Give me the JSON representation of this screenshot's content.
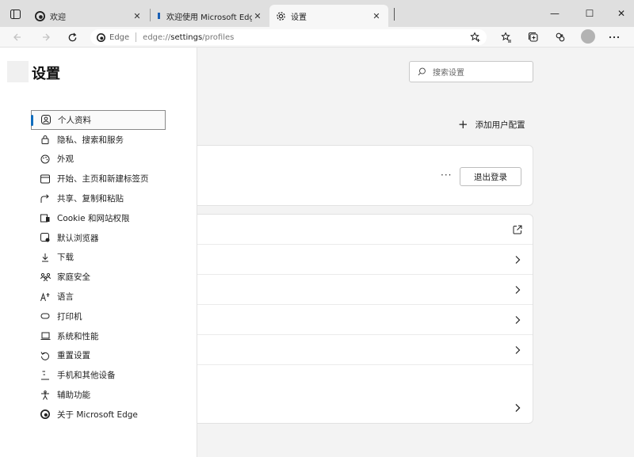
{
  "tabs": [
    {
      "label": "欢迎",
      "close": "✕"
    },
    {
      "label": "欢迎使用 Microsoft Edge",
      "close": "✕"
    },
    {
      "label": "设置",
      "close": "✕"
    }
  ],
  "window": {
    "minimize": "—",
    "maximize": "☐",
    "close": "✕"
  },
  "address": {
    "site": "Edge",
    "url_prefix": "edge://",
    "url_bold": "settings",
    "url_suffix": "/profiles"
  },
  "settings": {
    "title": "设置",
    "search_placeholder": "搜索设置",
    "add_profile": "添加用户配置",
    "more_label": "···",
    "signout_label": "退出登录"
  },
  "nav_items": [
    {
      "label": "个人资料",
      "icon": "profile-icon"
    },
    {
      "label": "隐私、搜索和服务",
      "icon": "lock-icon"
    },
    {
      "label": "外观",
      "icon": "appearance-icon"
    },
    {
      "label": "开始、主页和新建标签页",
      "icon": "home-tab-icon"
    },
    {
      "label": "共享、复制和粘贴",
      "icon": "share-icon"
    },
    {
      "label": "Cookie 和网站权限",
      "icon": "permissions-icon"
    },
    {
      "label": "默认浏览器",
      "icon": "default-browser-icon"
    },
    {
      "label": "下载",
      "icon": "download-icon"
    },
    {
      "label": "家庭安全",
      "icon": "family-icon"
    },
    {
      "label": "语言",
      "icon": "language-icon"
    },
    {
      "label": "打印机",
      "icon": "printer-icon"
    },
    {
      "label": "系统和性能",
      "icon": "laptop-icon"
    },
    {
      "label": "重置设置",
      "icon": "reset-icon"
    },
    {
      "label": "手机和其他设备",
      "icon": "phone-icon"
    },
    {
      "label": "辅助功能",
      "icon": "accessibility-icon"
    },
    {
      "label": "关于 Microsoft Edge",
      "icon": "edge-logo-icon"
    }
  ],
  "colors": {
    "accent": "#0f6cbd"
  }
}
